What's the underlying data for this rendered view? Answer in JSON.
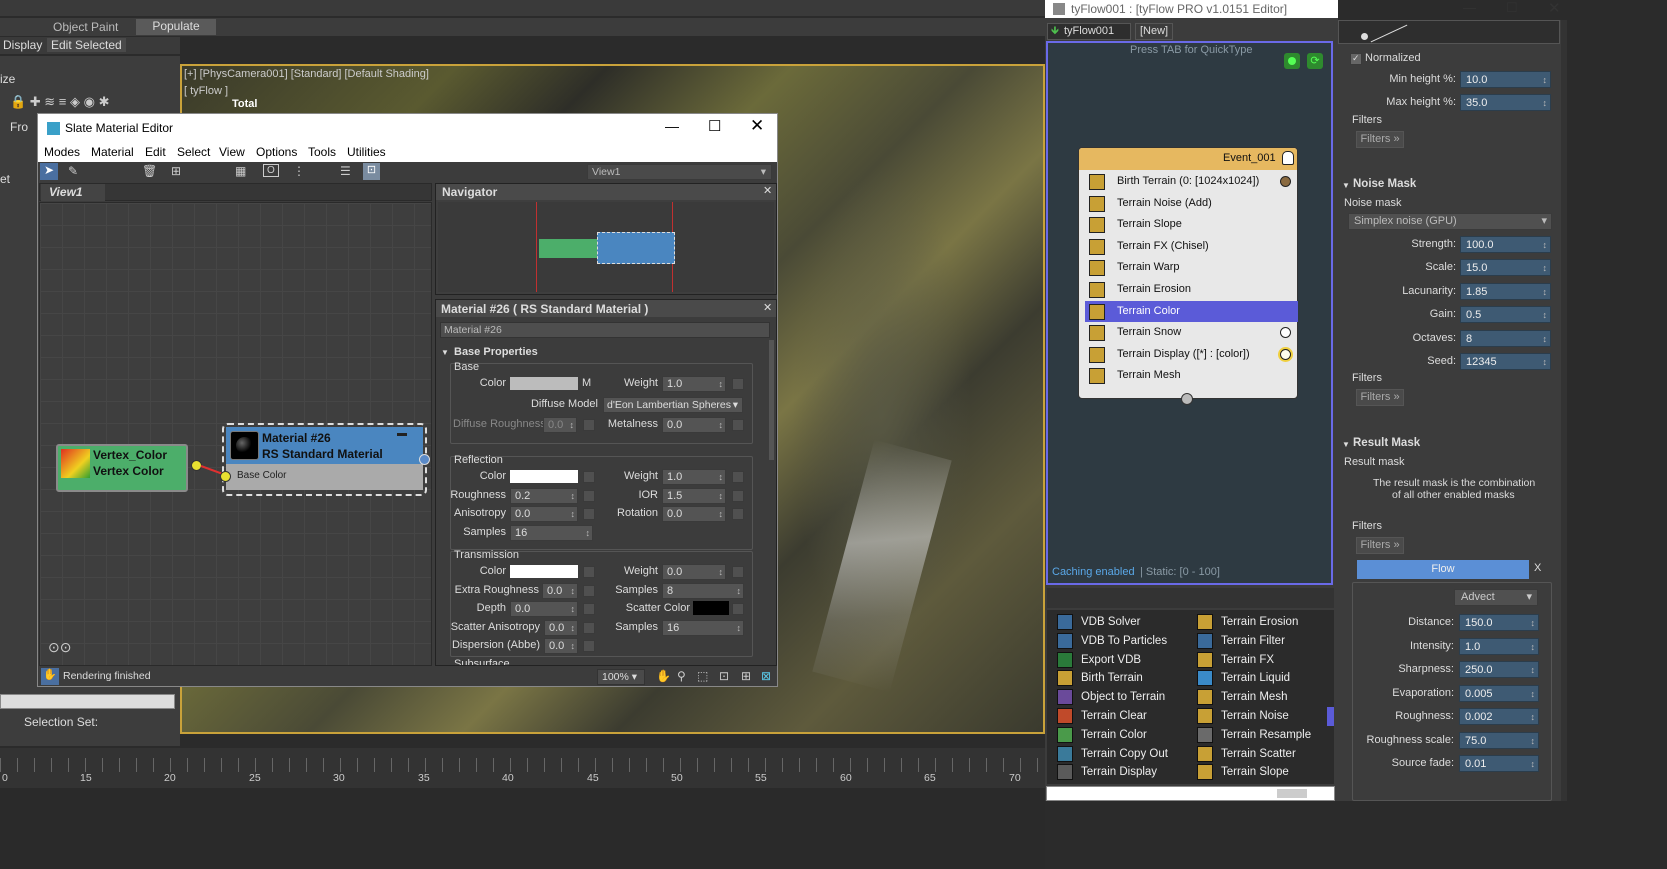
{
  "max_toolbar": {
    "object_paint": "Object Paint",
    "populate": "Populate",
    "display": "Display",
    "edit_selected": "Edit Selected"
  },
  "left_panel": {
    "ize": "ize",
    "fro": "Fro",
    "et": "et",
    "selection_set": "Selection Set:"
  },
  "viewport": {
    "label1": "[+] [PhysCamera001] [Standard] [Default Shading]",
    "label2": "[ tyFlow ]",
    "total": "Total"
  },
  "timeline": {
    "ticks": [
      "0",
      "15",
      "20",
      "25",
      "30",
      "35",
      "40",
      "45",
      "50",
      "55",
      "60",
      "65",
      "70"
    ]
  },
  "slate": {
    "title": "Slate Material Editor",
    "menu": [
      "Modes",
      "Material",
      "Edit",
      "Select",
      "View",
      "Options",
      "Tools",
      "Utilities"
    ],
    "view_dropdown": "View1",
    "view_tab": "View1",
    "node_vertex": {
      "line1": "Vertex_Color",
      "line2": "Vertex Color"
    },
    "node_material": {
      "line1": "Material #26",
      "line2": "RS Standard Material",
      "slot": "Base Color"
    },
    "status": "Rendering finished",
    "zoom": "100%",
    "navigator_title": "Navigator",
    "params_title": "Material #26  ( RS Standard Material )",
    "material_name": "Material #26",
    "base_properties": "Base Properties",
    "base": {
      "group": "Base",
      "color": "Color",
      "m": "M",
      "weight_label": "Weight",
      "weight": "1.0",
      "diffuse_model_label": "Diffuse Model",
      "diffuse_model": "d'Eon Lambertian Spheres",
      "diffuse_roughness_label": "Diffuse Roughness",
      "diffuse_roughness": "0.0",
      "metalness_label": "Metalness",
      "metalness": "0.0"
    },
    "reflection": {
      "group": "Reflection",
      "color": "Color",
      "weight_label": "Weight",
      "weight": "1.0",
      "roughness_label": "Roughness",
      "roughness": "0.2",
      "ior_label": "IOR",
      "ior": "1.5",
      "anisotropy_label": "Anisotropy",
      "anisotropy": "0.0",
      "rotation_label": "Rotation",
      "rotation": "0.0",
      "samples_label": "Samples",
      "samples": "16"
    },
    "transmission": {
      "group": "Transmission",
      "color": "Color",
      "weight_label": "Weight",
      "weight": "0.0",
      "extra_roughness_label": "Extra Roughness",
      "extra_roughness": "0.0",
      "samples_label": "Samples",
      "samples": "8",
      "depth_label": "Depth",
      "depth": "0.0",
      "scatter_color_label": "Scatter Color",
      "scatter_anisotropy_label": "Scatter Anisotropy",
      "scatter_anisotropy": "0.0",
      "samples2_label": "Samples",
      "samples2": "16",
      "dispersion_label": "Dispersion (Abbe)",
      "dispersion": "0.0"
    },
    "subsurface": "Subsurface"
  },
  "tyflow": {
    "title": "tyFlow001 : [tyFlow PRO v1.0151 Editor]",
    "tab1": "tyFlow001",
    "tab2": "[New]",
    "quicktype": "Press TAB for QuickType",
    "event_name": "Event_001",
    "operators": [
      {
        "label": "Birth Terrain (0: [1024x1024])"
      },
      {
        "label": "Terrain Noise (Add)"
      },
      {
        "label": "Terrain Slope"
      },
      {
        "label": "Terrain FX (Chisel)"
      },
      {
        "label": "Terrain Warp"
      },
      {
        "label": "Terrain Erosion"
      },
      {
        "label": "Terrain Color"
      },
      {
        "label": "Terrain Snow"
      },
      {
        "label": "Terrain Display ([*] : [color])"
      },
      {
        "label": "Terrain Mesh"
      }
    ],
    "caching": "Caching enabled",
    "static": " | Static: [0 - 100]",
    "depot_left": [
      "VDB Solver",
      "VDB To Particles",
      "Export VDB",
      "Birth Terrain",
      "Object to Terrain",
      "Terrain Clear",
      "Terrain Color",
      "Terrain Copy Out",
      "Terrain Display"
    ],
    "depot_right": [
      "Terrain Erosion",
      "Terrain Filter",
      "Terrain FX",
      "Terrain Liquid",
      "Terrain Mesh",
      "Terrain Noise",
      "Terrain Resample",
      "Terrain Scatter",
      "Terrain Slope"
    ]
  },
  "props": {
    "normalized": "Normalized",
    "min_height_label": "Min height %:",
    "min_height": "10.0",
    "max_height_label": "Max height %:",
    "max_height": "35.0",
    "filters": "Filters",
    "filters_btn": "Filters »",
    "noise_mask_title": "Noise Mask",
    "noise_mask_label": "Noise mask",
    "noise_type": "Simplex noise (GPU)",
    "strength_label": "Strength:",
    "strength": "100.0",
    "scale_label": "Scale:",
    "scale": "15.0",
    "lacunarity_label": "Lacunarity:",
    "lacunarity": "1.85",
    "gain_label": "Gain:",
    "gain": "0.5",
    "octaves_label": "Octaves:",
    "octaves": "8",
    "seed_label": "Seed:",
    "seed": "12345",
    "result_mask_title": "Result Mask",
    "result_mask_label": "Result mask",
    "result_desc1": "The result mask is the combination",
    "result_desc2": "of all other enabled masks",
    "flow": "Flow",
    "x": "X",
    "advect": "Advect",
    "distance_label": "Distance:",
    "distance": "150.0",
    "intensity_label": "Intensity:",
    "intensity": "1.0",
    "sharpness_label": "Sharpness:",
    "sharpness": "250.0",
    "evaporation_label": "Evaporation:",
    "evaporation": "0.005",
    "roughness_label": "Roughness:",
    "roughness": "0.002",
    "roughness_scale_label": "Roughness scale:",
    "roughness_scale": "75.0",
    "source_fade_label": "Source fade:",
    "source_fade": "0.01"
  },
  "colors": {
    "accent": "#5b8fd6",
    "event_header": "#e6b860",
    "selected": "#5b5bd8",
    "vertex_node": "#4cae6a",
    "material_node": "#4a86c0"
  }
}
